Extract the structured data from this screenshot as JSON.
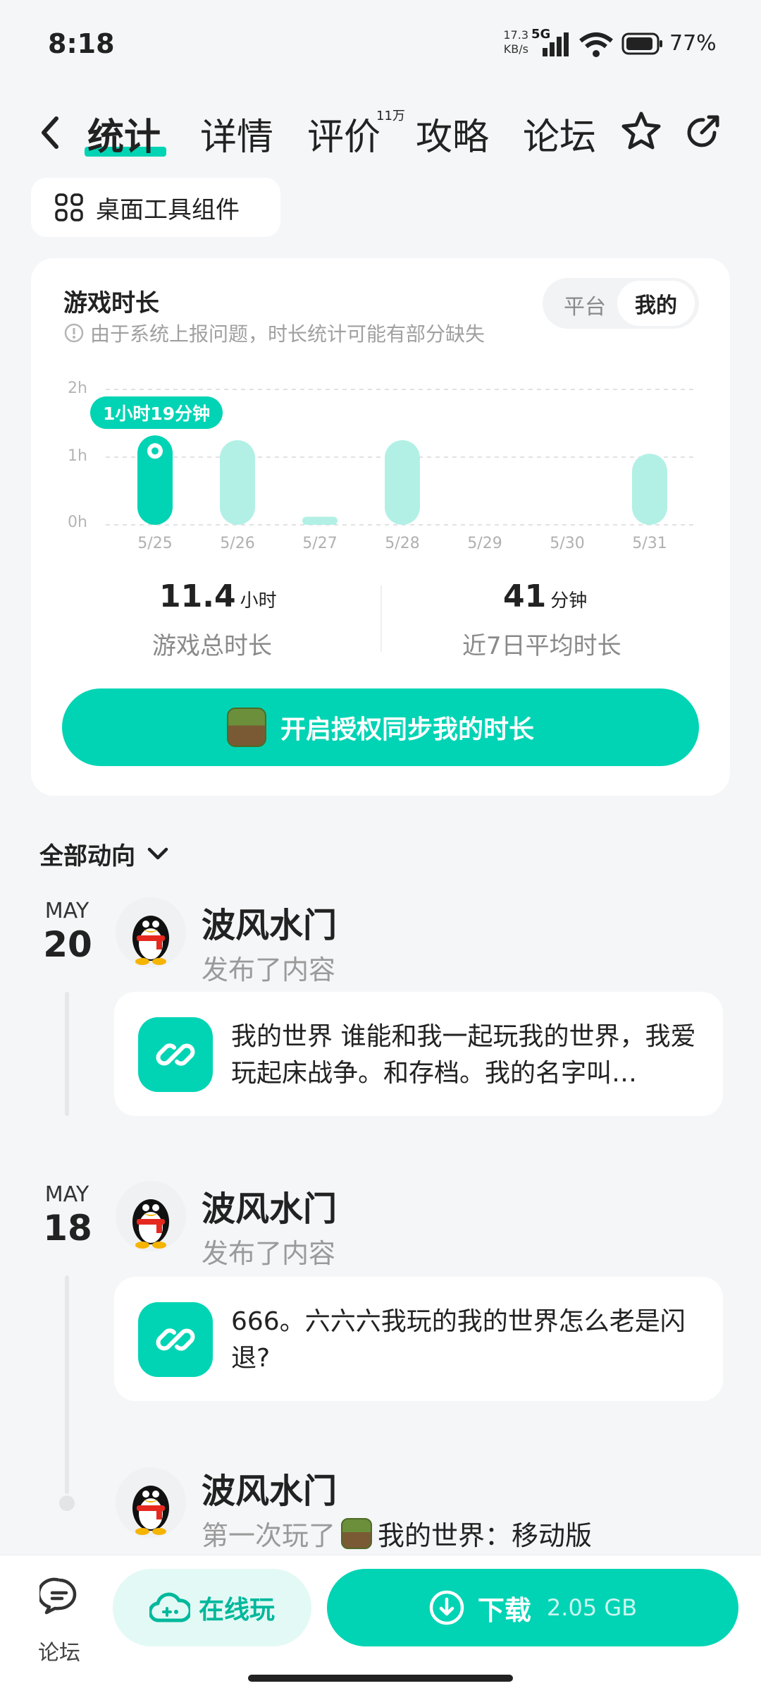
{
  "status": {
    "time": "8:18",
    "net_speed_top": "17.3",
    "net_speed_bottom": "KB/s",
    "network": "5G",
    "battery": "77%"
  },
  "nav": {
    "tabs": [
      {
        "label": "统计"
      },
      {
        "label": "详情"
      },
      {
        "label": "评价"
      },
      {
        "label": "攻略"
      },
      {
        "label": "论坛"
      }
    ],
    "review_badge": "11万",
    "icons": [
      "back-icon",
      "star-icon",
      "share-icon"
    ]
  },
  "widget": {
    "label": "桌面工具组件"
  },
  "playtime": {
    "title": "游戏时长",
    "note": "由于系统上报问题，时长统计可能有部分缺失",
    "toggle": {
      "platform": "平台",
      "mine": "我的"
    },
    "tooltip": "1小时19分钟",
    "total": {
      "value": "11.4",
      "unit": "小时",
      "label": "游戏总时长"
    },
    "avg": {
      "value": "41",
      "unit": "分钟",
      "label": "近7日平均时长"
    },
    "cta": "开启授权同步我的时长"
  },
  "chart_data": {
    "type": "bar",
    "categories": [
      "5/25",
      "5/26",
      "5/27",
      "5/28",
      "5/29",
      "5/30",
      "5/31"
    ],
    "values": [
      1.32,
      1.25,
      0.12,
      1.25,
      0,
      0,
      1.05
    ],
    "ylabel": "",
    "y_ticks": [
      "2h",
      "1h",
      "0h"
    ],
    "ylim": [
      0,
      2
    ],
    "highlight_index": 0,
    "colors": {
      "selected": "#00d4b4",
      "normal": "#b2f0e6"
    }
  },
  "feed": {
    "filter": "全部动向",
    "items": [
      {
        "month": "MAY",
        "day": "20",
        "user": "波风水门",
        "action": "发布了内容",
        "text": "我的世界 谁能和我一起玩我的世界，我爱玩起床战争。和存档。我的名字叫…"
      },
      {
        "month": "MAY",
        "day": "18",
        "user": "波风水门",
        "action": "发布了内容",
        "text": "666。六六六我玩的我的世界怎么老是闪退?"
      },
      {
        "user": "波风水门",
        "action_prefix": "第一次玩了",
        "game": "我的世界：移动版"
      }
    ]
  },
  "bottom": {
    "forum": "论坛",
    "play": "在线玩",
    "download": "下载",
    "size": "2.05 GB"
  },
  "colors": {
    "accent": "#00d4b4",
    "bar_light": "#b2f0e6"
  }
}
